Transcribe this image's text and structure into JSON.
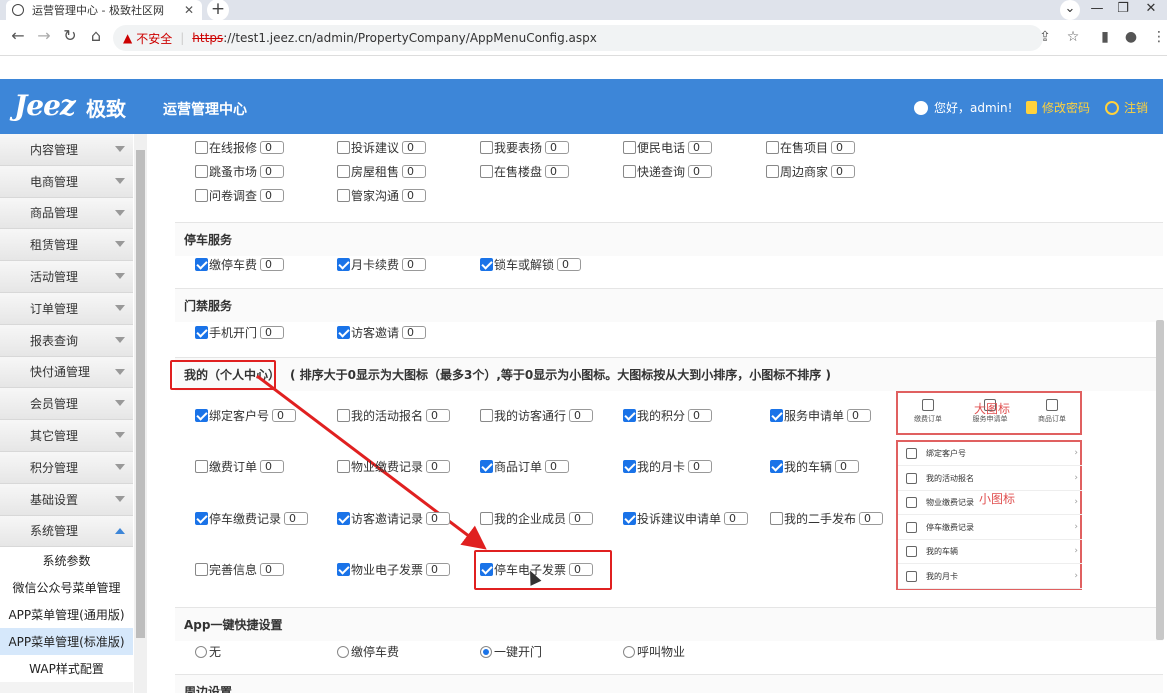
{
  "browser": {
    "tab_title": "运营管理中心 - 极致社区网",
    "insecure_label": "不安全",
    "url_scheme": "https",
    "url_rest": "://test1.jeez.cn/admin/PropertyCompany/AppMenuConfig.aspx"
  },
  "header": {
    "logo_latin": "Jeez",
    "logo_cn": "极致",
    "app_title": "运营管理中心",
    "greeting": "您好，admin!",
    "change_password": "修改密码",
    "logout": "注销"
  },
  "sidebar": {
    "menus": [
      "内容管理",
      "电商管理",
      "商品管理",
      "租赁管理",
      "活动管理",
      "订单管理",
      "报表查询",
      "快付通管理",
      "会员管理",
      "其它管理",
      "积分管理",
      "基础设置",
      "系统管理"
    ],
    "sub_items": [
      "系统参数",
      "微信公众号菜单管理",
      "APP菜单管理(通用版)",
      "APP菜单管理(标准版)",
      "WAP样式配置"
    ]
  },
  "top_rows": [
    [
      {
        "label": "在线报修",
        "value": "0"
      },
      {
        "label": "投诉建议",
        "value": "0"
      },
      {
        "label": "我要表扬",
        "value": "0"
      },
      {
        "label": "便民电话",
        "value": "0"
      },
      {
        "label": "在售项目",
        "value": "0"
      }
    ],
    [
      {
        "label": "跳蚤市场",
        "value": "0"
      },
      {
        "label": "房屋租售",
        "value": "0"
      },
      {
        "label": "在售楼盘",
        "value": "0"
      },
      {
        "label": "快递查询",
        "value": "0"
      },
      {
        "label": "周边商家",
        "value": "0"
      }
    ],
    [
      {
        "label": "问卷调查",
        "value": "0"
      },
      {
        "label": "管家沟通",
        "value": "0"
      }
    ]
  ],
  "parking": {
    "title": "停车服务",
    "items": [
      {
        "label": "缴停车费",
        "value": "0",
        "checked": true
      },
      {
        "label": "月卡续费",
        "value": "0",
        "checked": true
      },
      {
        "label": "锁车或解锁",
        "value": "0",
        "checked": true
      }
    ]
  },
  "access": {
    "title": "门禁服务",
    "items": [
      {
        "label": "手机开门",
        "value": "0",
        "checked": true
      },
      {
        "label": "访客邀请",
        "value": "0",
        "checked": true
      }
    ]
  },
  "mine": {
    "title": "我的（个人中心）",
    "note": "( 排序大于0显示为大图标（最多3个）,等于0显示为小图标。大图标按从大到小排序，小图标不排序 )",
    "rows": [
      [
        {
          "label": "绑定客户号",
          "value": "0",
          "checked": true
        },
        {
          "label": "我的活动报名",
          "value": "0",
          "checked": false
        },
        {
          "label": "我的访客通行",
          "value": "0",
          "checked": false
        },
        {
          "label": "我的积分",
          "value": "0",
          "checked": true
        },
        {
          "label": "服务申请单",
          "value": "0",
          "checked": true
        }
      ],
      [
        {
          "label": "缴费订单",
          "value": "0",
          "checked": false
        },
        {
          "label": "物业缴费记录",
          "value": "0",
          "checked": false
        },
        {
          "label": "商品订单",
          "value": "0",
          "checked": true
        },
        {
          "label": "我的月卡",
          "value": "0",
          "checked": true
        },
        {
          "label": "我的车辆",
          "value": "0",
          "checked": true
        }
      ],
      [
        {
          "label": "停车缴费记录",
          "value": "0",
          "checked": true
        },
        {
          "label": "访客邀请记录",
          "value": "0",
          "checked": true
        },
        {
          "label": "我的企业成员",
          "value": "0",
          "checked": false
        },
        {
          "label": "投诉建议申请单",
          "value": "0",
          "checked": true
        },
        {
          "label": "我的二手发布",
          "value": "0",
          "checked": false
        }
      ],
      [
        {
          "label": "完善信息",
          "value": "0",
          "checked": false
        },
        {
          "label": "物业电子发票",
          "value": "0",
          "checked": true
        },
        {
          "label": "停车电子发票",
          "value": "0",
          "checked": true
        }
      ]
    ]
  },
  "mock": {
    "big_label": "大图标",
    "small_label": "小图标",
    "big_icons": [
      "缴费订单",
      "服务申请单",
      "商品订单"
    ],
    "small_list": [
      "绑定客户号",
      "我的活动报名",
      "物业缴费记录",
      "停车缴费记录",
      "我的车辆",
      "我的月卡"
    ]
  },
  "quick": {
    "title": "App一键快捷设置",
    "options": [
      {
        "label": "无",
        "selected": false
      },
      {
        "label": "缴停车费",
        "selected": false
      },
      {
        "label": "一键开门",
        "selected": true
      },
      {
        "label": "呼叫物业",
        "selected": false
      }
    ]
  },
  "next_section_title": "周边设置",
  "colors": {
    "header": "#3d86d8",
    "highlight": "#e02020",
    "checkbox": "#1a73e8"
  }
}
